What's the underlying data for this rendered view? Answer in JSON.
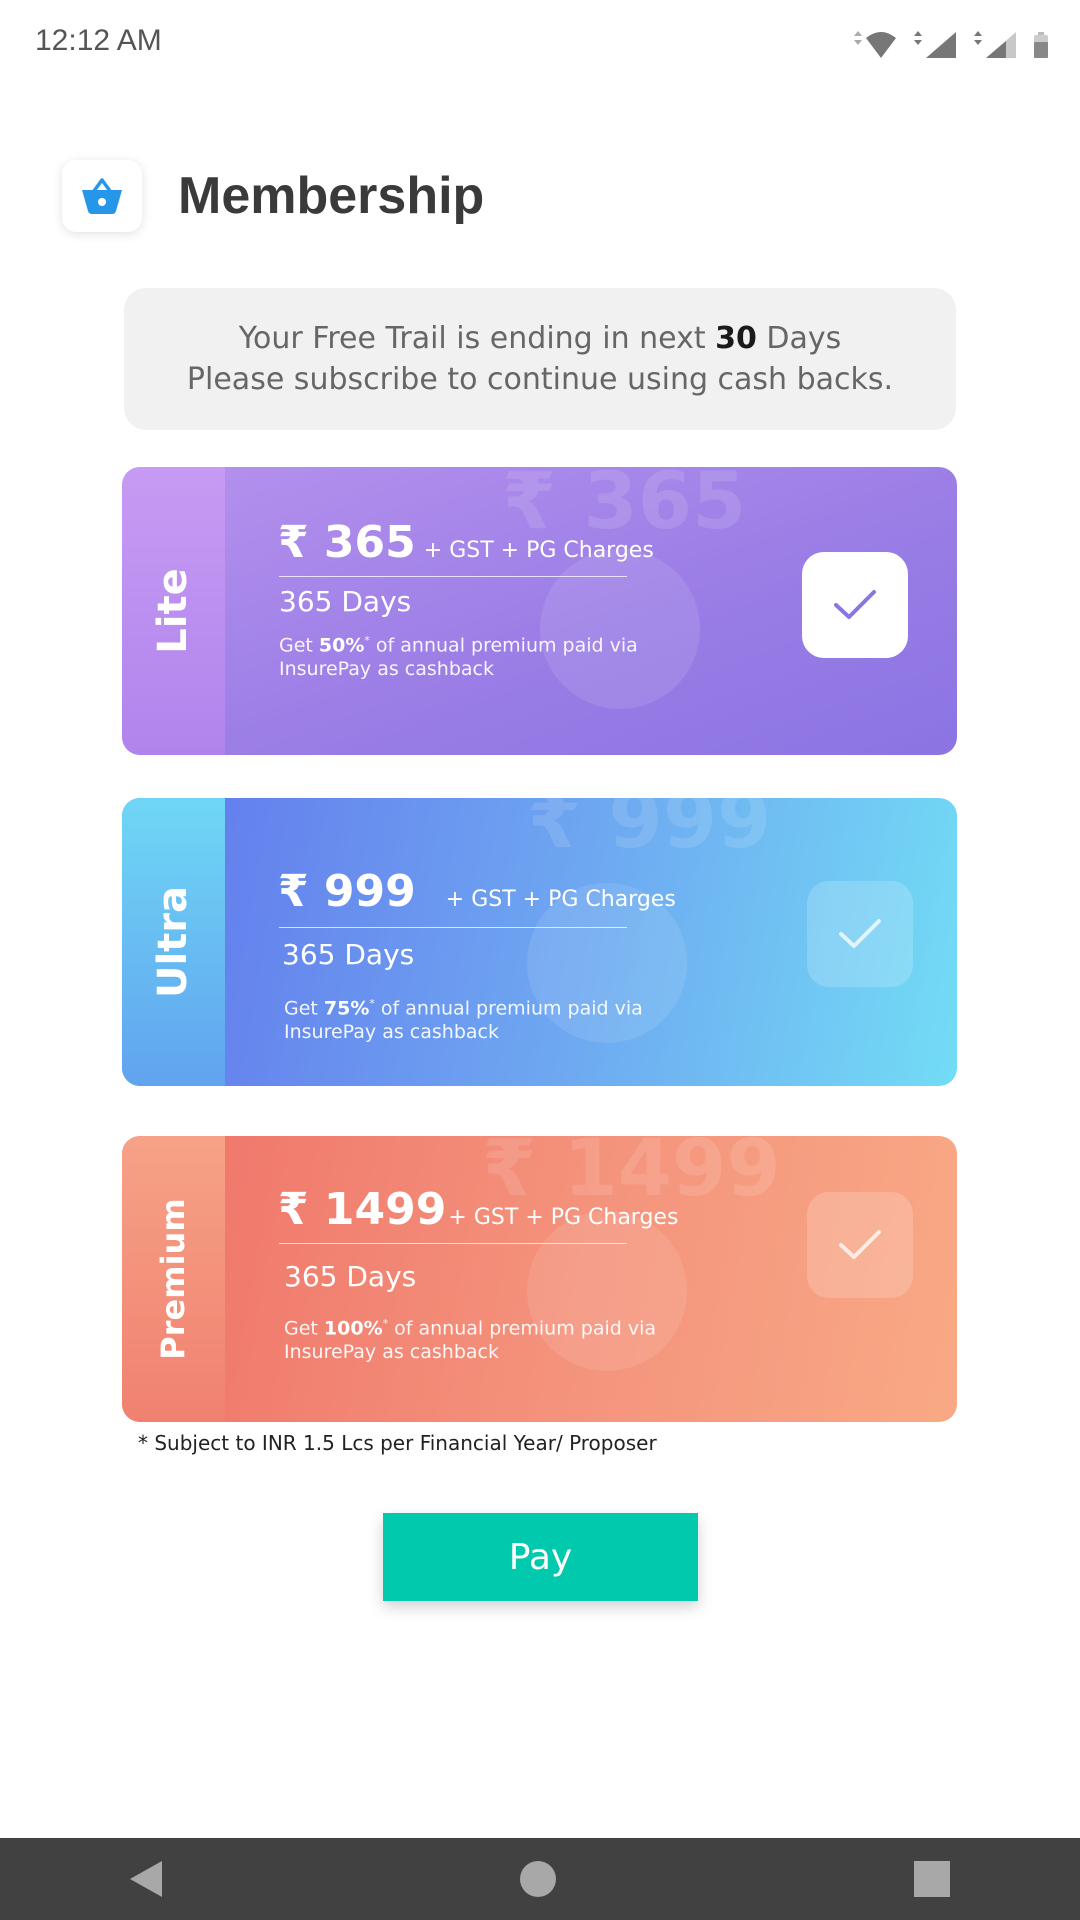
{
  "status_bar": {
    "time": "12:12 AM",
    "icons": [
      "wifi-icon",
      "signal-icon",
      "signal-icon",
      "battery-icon"
    ]
  },
  "header": {
    "icon": "basket-icon",
    "title": "Membership"
  },
  "notice": {
    "line1_prefix": "Your Free Trail is ending in next ",
    "days_count": "30",
    "line1_suffix": " Days",
    "line2": "Please subscribe to continue using cash backs."
  },
  "plans": [
    {
      "name": "Lite",
      "watermark": "₹ 365",
      "price": "₹ 365",
      "charges": "+ GST + PG Charges",
      "duration": "365 Days",
      "desc_prefix": "Get ",
      "cashback": "50%",
      "asterisk": "*",
      "desc_suffix": " of annual premium paid via InsurePay as cashback",
      "selected": true
    },
    {
      "name": "Ultra",
      "watermark": "₹ 999",
      "price": "₹ 999",
      "charges": "+ GST + PG Charges",
      "duration": "365 Days",
      "desc_prefix": "Get ",
      "cashback": "75%",
      "asterisk": "*",
      "desc_suffix": " of annual premium paid via InsurePay as cashback",
      "selected": false
    },
    {
      "name": "Premium",
      "watermark": "₹ 1499",
      "price": "₹ 1499",
      "charges": "+ GST + PG Charges",
      "duration": "365 Days",
      "desc_prefix": "Get ",
      "cashback": "100%",
      "asterisk": "*",
      "desc_suffix": " of annual premium paid via InsurePay as cashback",
      "selected": false
    }
  ],
  "footnote": "* Subject to INR 1.5 Lcs per Financial Year/ Proposer",
  "pay_button": "Pay",
  "nav": [
    "back-icon",
    "home-icon",
    "recents-icon"
  ],
  "colors": {
    "pay_button": "#00c9ad",
    "lite": "#9b7ee6",
    "ultra": "#6ea8f1",
    "premium": "#f4937c",
    "nav_bar": "#414141"
  }
}
